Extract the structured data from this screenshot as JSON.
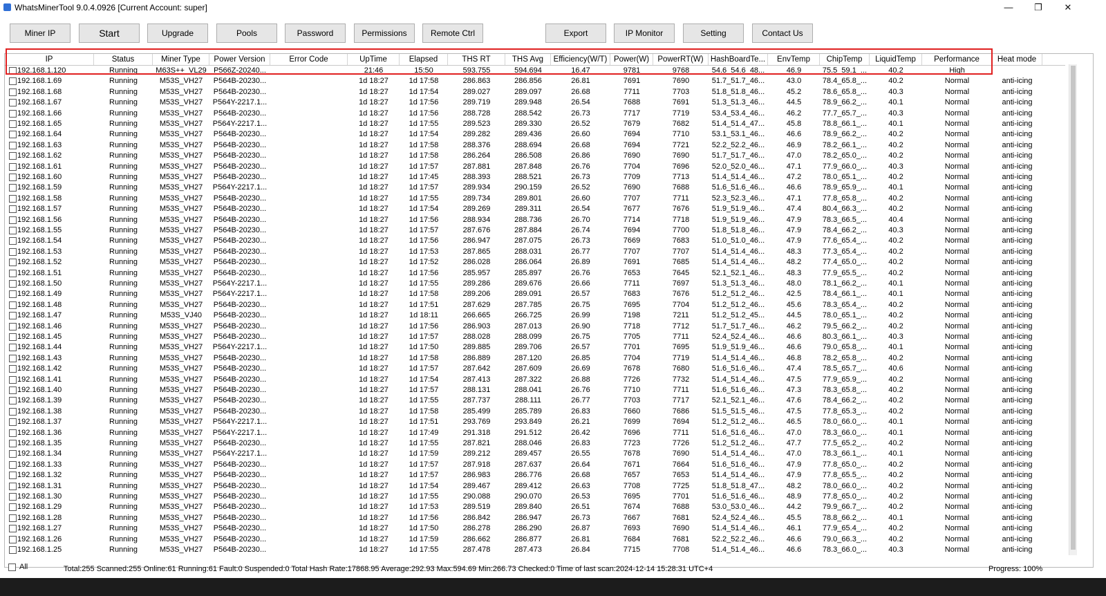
{
  "window": {
    "title": "WhatsMinerTool 9.0.4.0926 [Current Account: super]",
    "minimize": "—",
    "maximize": "❐",
    "close": "✕"
  },
  "toolbar": [
    {
      "label": "Miner IP"
    },
    {
      "label": "Start"
    },
    {
      "label": "Upgrade"
    },
    {
      "label": "Pools"
    },
    {
      "label": "Password"
    },
    {
      "label": "Permissions"
    },
    {
      "label": "Remote Ctrl"
    },
    {
      "label": "Export"
    },
    {
      "label": "IP Monitor"
    },
    {
      "label": "Setting"
    },
    {
      "label": "Contact Us"
    }
  ],
  "columns": [
    "IP",
    "Status",
    "Miner Type",
    "Power Version",
    "Error Code",
    "UpTime",
    "Elapsed",
    "THS RT",
    "THS Avg",
    "Efficiency(W/T)",
    "Power(W)",
    "PowerRT(W)",
    "HashBoardTe...",
    "EnvTemp",
    "ChipTemp",
    "LiquidTemp",
    "Performance",
    "Heat mode"
  ],
  "rows": [
    [
      "192.168.1.120",
      "Running",
      "M63S++_VL29",
      "P566Z-20240...",
      "",
      "21:46",
      "15:50",
      "593.755",
      "594.694",
      "16.47",
      "9781",
      "9768",
      "54.6_54.6_48...",
      "46.9",
      "75.5_59.1_...",
      "40.2",
      "High",
      ""
    ],
    [
      "192.168.1.69",
      "Running",
      "M53S_VH27",
      "P564B-20230...",
      "",
      "1d 18:27",
      "1d 17:58",
      "286.863",
      "286.856",
      "26.81",
      "7691",
      "7690",
      "51.7_51.7_46...",
      "43.0",
      "78.4_65.8_...",
      "40.2",
      "Normal",
      "anti-icing"
    ],
    [
      "192.168.1.68",
      "Running",
      "M53S_VH27",
      "P564B-20230...",
      "",
      "1d 18:27",
      "1d 17:54",
      "289.027",
      "289.097",
      "26.68",
      "7711",
      "7703",
      "51.8_51.8_46...",
      "45.2",
      "78.6_65.8_...",
      "40.3",
      "Normal",
      "anti-icing"
    ],
    [
      "192.168.1.67",
      "Running",
      "M53S_VH27",
      "P564Y-2217.1...",
      "",
      "1d 18:27",
      "1d 17:56",
      "289.719",
      "289.948",
      "26.54",
      "7688",
      "7691",
      "51.3_51.3_46...",
      "44.5",
      "78.9_66.2_...",
      "40.1",
      "Normal",
      "anti-icing"
    ],
    [
      "192.168.1.66",
      "Running",
      "M53S_VH27",
      "P564B-20230...",
      "",
      "1d 18:27",
      "1d 17:56",
      "288.728",
      "288.542",
      "26.73",
      "7717",
      "7719",
      "53.4_53.4_46...",
      "46.2",
      "77.7_65.7_...",
      "40.3",
      "Normal",
      "anti-icing"
    ],
    [
      "192.168.1.65",
      "Running",
      "M53S_VH27",
      "P564Y-2217.1...",
      "",
      "1d 18:27",
      "1d 17:55",
      "289.523",
      "289.330",
      "26.52",
      "7679",
      "7682",
      "51.4_51.4_47...",
      "45.8",
      "78.8_66.1_...",
      "40.1",
      "Normal",
      "anti-icing"
    ],
    [
      "192.168.1.64",
      "Running",
      "M53S_VH27",
      "P564B-20230...",
      "",
      "1d 18:27",
      "1d 17:54",
      "289.282",
      "289.436",
      "26.60",
      "7694",
      "7710",
      "53.1_53.1_46...",
      "46.6",
      "78.9_66.2_...",
      "40.2",
      "Normal",
      "anti-icing"
    ],
    [
      "192.168.1.63",
      "Running",
      "M53S_VH27",
      "P564B-20230...",
      "",
      "1d 18:27",
      "1d 17:58",
      "288.376",
      "288.694",
      "26.68",
      "7694",
      "7721",
      "52.2_52.2_46...",
      "46.9",
      "78.2_66.1_...",
      "40.2",
      "Normal",
      "anti-icing"
    ],
    [
      "192.168.1.62",
      "Running",
      "M53S_VH27",
      "P564B-20230...",
      "",
      "1d 18:27",
      "1d 17:58",
      "286.264",
      "286.508",
      "26.86",
      "7690",
      "7690",
      "51.7_51.7_46...",
      "47.0",
      "78.2_65.0_...",
      "40.2",
      "Normal",
      "anti-icing"
    ],
    [
      "192.168.1.61",
      "Running",
      "M53S_VH27",
      "P564B-20230...",
      "",
      "1d 18:27",
      "1d 17:57",
      "287.881",
      "287.848",
      "26.76",
      "7704",
      "7696",
      "52.0_52.0_46...",
      "47.1",
      "77.9_66.0_...",
      "40.3",
      "Normal",
      "anti-icing"
    ],
    [
      "192.168.1.60",
      "Running",
      "M53S_VH27",
      "P564B-20230...",
      "",
      "1d 18:27",
      "1d 17:45",
      "288.393",
      "288.521",
      "26.73",
      "7709",
      "7713",
      "51.4_51.4_46...",
      "47.2",
      "78.0_65.1_...",
      "40.2",
      "Normal",
      "anti-icing"
    ],
    [
      "192.168.1.59",
      "Running",
      "M53S_VH27",
      "P564Y-2217.1...",
      "",
      "1d 18:27",
      "1d 17:57",
      "289.934",
      "290.159",
      "26.52",
      "7690",
      "7688",
      "51.6_51.6_46...",
      "46.6",
      "78.9_65.9_...",
      "40.1",
      "Normal",
      "anti-icing"
    ],
    [
      "192.168.1.58",
      "Running",
      "M53S_VH27",
      "P564B-20230...",
      "",
      "1d 18:27",
      "1d 17:55",
      "289.734",
      "289.801",
      "26.60",
      "7707",
      "7711",
      "52.3_52.3_46...",
      "47.1",
      "77.8_65.8_...",
      "40.2",
      "Normal",
      "anti-icing"
    ],
    [
      "192.168.1.57",
      "Running",
      "M53S_VH27",
      "P564B-20230...",
      "",
      "1d 18:27",
      "1d 17:54",
      "289.269",
      "289.311",
      "26.54",
      "7677",
      "7676",
      "51.9_51.9_46...",
      "47.4",
      "80.4_66.3_...",
      "40.2",
      "Normal",
      "anti-icing"
    ],
    [
      "192.168.1.56",
      "Running",
      "M53S_VH27",
      "P564B-20230...",
      "",
      "1d 18:27",
      "1d 17:56",
      "288.934",
      "288.736",
      "26.70",
      "7714",
      "7718",
      "51.9_51.9_46...",
      "47.9",
      "78.3_66.5_...",
      "40.4",
      "Normal",
      "anti-icing"
    ],
    [
      "192.168.1.55",
      "Running",
      "M53S_VH27",
      "P564B-20230...",
      "",
      "1d 18:27",
      "1d 17:57",
      "287.676",
      "287.884",
      "26.74",
      "7694",
      "7700",
      "51.8_51.8_46...",
      "47.9",
      "78.4_66.2_...",
      "40.3",
      "Normal",
      "anti-icing"
    ],
    [
      "192.168.1.54",
      "Running",
      "M53S_VH27",
      "P564B-20230...",
      "",
      "1d 18:27",
      "1d 17:56",
      "286.947",
      "287.075",
      "26.73",
      "7669",
      "7683",
      "51.0_51.0_46...",
      "47.9",
      "77.6_65.4_...",
      "40.2",
      "Normal",
      "anti-icing"
    ],
    [
      "192.168.1.53",
      "Running",
      "M53S_VH27",
      "P564B-20230...",
      "",
      "1d 18:27",
      "1d 17:53",
      "287.865",
      "288.031",
      "26.77",
      "7707",
      "7707",
      "51.4_51.4_46...",
      "48.3",
      "77.3_65.4_...",
      "40.2",
      "Normal",
      "anti-icing"
    ],
    [
      "192.168.1.52",
      "Running",
      "M53S_VH27",
      "P564B-20230...",
      "",
      "1d 18:27",
      "1d 17:52",
      "286.028",
      "286.064",
      "26.89",
      "7691",
      "7685",
      "51.4_51.4_46...",
      "48.2",
      "77.4_65.0_...",
      "40.2",
      "Normal",
      "anti-icing"
    ],
    [
      "192.168.1.51",
      "Running",
      "M53S_VH27",
      "P564B-20230...",
      "",
      "1d 18:27",
      "1d 17:56",
      "285.957",
      "285.897",
      "26.76",
      "7653",
      "7645",
      "52.1_52.1_46...",
      "48.3",
      "77.9_65.5_...",
      "40.2",
      "Normal",
      "anti-icing"
    ],
    [
      "192.168.1.50",
      "Running",
      "M53S_VH27",
      "P564Y-2217.1...",
      "",
      "1d 18:27",
      "1d 17:55",
      "289.286",
      "289.676",
      "26.66",
      "7711",
      "7697",
      "51.3_51.3_46...",
      "48.0",
      "78.1_66.2_...",
      "40.1",
      "Normal",
      "anti-icing"
    ],
    [
      "192.168.1.49",
      "Running",
      "M53S_VH27",
      "P564Y-2217.1...",
      "",
      "1d 18:27",
      "1d 17:58",
      "289.206",
      "289.091",
      "26.57",
      "7683",
      "7676",
      "51.2_51.2_46...",
      "42.5",
      "78.4_66.1_...",
      "40.1",
      "Normal",
      "anti-icing"
    ],
    [
      "192.168.1.48",
      "Running",
      "M53S_VH27",
      "P564B-20230...",
      "",
      "1d 18:27",
      "1d 17:51",
      "287.629",
      "287.785",
      "26.75",
      "7695",
      "7704",
      "51.2_51.2_46...",
      "45.6",
      "78.3_65.4_...",
      "40.2",
      "Normal",
      "anti-icing"
    ],
    [
      "192.168.1.47",
      "Running",
      "M53S_VJ40",
      "P564B-20230...",
      "",
      "1d 18:27",
      "1d 18:11",
      "266.665",
      "266.725",
      "26.99",
      "7198",
      "7211",
      "51.2_51.2_45...",
      "44.5",
      "78.0_65.1_...",
      "40.2",
      "Normal",
      "anti-icing"
    ],
    [
      "192.168.1.46",
      "Running",
      "M53S_VH27",
      "P564B-20230...",
      "",
      "1d 18:27",
      "1d 17:56",
      "286.903",
      "287.013",
      "26.90",
      "7718",
      "7712",
      "51.7_51.7_46...",
      "46.2",
      "79.5_66.2_...",
      "40.2",
      "Normal",
      "anti-icing"
    ],
    [
      "192.168.1.45",
      "Running",
      "M53S_VH27",
      "P564B-20230...",
      "",
      "1d 18:27",
      "1d 17:57",
      "288.028",
      "288.099",
      "26.75",
      "7705",
      "7711",
      "52.4_52.4_46...",
      "46.6",
      "80.3_66.1_...",
      "40.3",
      "Normal",
      "anti-icing"
    ],
    [
      "192.168.1.44",
      "Running",
      "M53S_VH27",
      "P564Y-2217.1...",
      "",
      "1d 18:27",
      "1d 17:50",
      "289.885",
      "289.706",
      "26.57",
      "7701",
      "7695",
      "51.9_51.9_46...",
      "46.6",
      "79.0_65.8_...",
      "40.1",
      "Normal",
      "anti-icing"
    ],
    [
      "192.168.1.43",
      "Running",
      "M53S_VH27",
      "P564B-20230...",
      "",
      "1d 18:27",
      "1d 17:58",
      "286.889",
      "287.120",
      "26.85",
      "7704",
      "7719",
      "51.4_51.4_46...",
      "46.8",
      "78.2_65.8_...",
      "40.2",
      "Normal",
      "anti-icing"
    ],
    [
      "192.168.1.42",
      "Running",
      "M53S_VH27",
      "P564B-20230...",
      "",
      "1d 18:27",
      "1d 17:57",
      "287.642",
      "287.609",
      "26.69",
      "7678",
      "7680",
      "51.6_51.6_46...",
      "47.4",
      "78.5_65.7_...",
      "40.6",
      "Normal",
      "anti-icing"
    ],
    [
      "192.168.1.41",
      "Running",
      "M53S_VH27",
      "P564B-20230...",
      "",
      "1d 18:27",
      "1d 17:54",
      "287.413",
      "287.322",
      "26.88",
      "7726",
      "7732",
      "51.4_51.4_46...",
      "47.5",
      "77.9_65.9_...",
      "40.2",
      "Normal",
      "anti-icing"
    ],
    [
      "192.168.1.40",
      "Running",
      "M53S_VH27",
      "P564B-20230...",
      "",
      "1d 18:27",
      "1d 17:57",
      "288.131",
      "288.041",
      "26.76",
      "7710",
      "7711",
      "51.6_51.6_46...",
      "47.3",
      "78.3_65.8_...",
      "40.2",
      "Normal",
      "anti-icing"
    ],
    [
      "192.168.1.39",
      "Running",
      "M53S_VH27",
      "P564B-20230...",
      "",
      "1d 18:27",
      "1d 17:55",
      "287.737",
      "288.111",
      "26.77",
      "7703",
      "7717",
      "52.1_52.1_46...",
      "47.6",
      "78.4_66.2_...",
      "40.2",
      "Normal",
      "anti-icing"
    ],
    [
      "192.168.1.38",
      "Running",
      "M53S_VH27",
      "P564B-20230...",
      "",
      "1d 18:27",
      "1d 17:58",
      "285.499",
      "285.789",
      "26.83",
      "7660",
      "7686",
      "51.5_51.5_46...",
      "47.5",
      "77.8_65.3_...",
      "40.2",
      "Normal",
      "anti-icing"
    ],
    [
      "192.168.1.37",
      "Running",
      "M53S_VH27",
      "P564Y-2217.1...",
      "",
      "1d 18:27",
      "1d 17:51",
      "293.769",
      "293.849",
      "26.21",
      "7699",
      "7694",
      "51.2_51.2_46...",
      "46.5",
      "78.0_66.0_...",
      "40.1",
      "Normal",
      "anti-icing"
    ],
    [
      "192.168.1.36",
      "Running",
      "M53S_VH27",
      "P564Y-2217.1...",
      "",
      "1d 18:27",
      "1d 17:49",
      "291.318",
      "291.512",
      "26.42",
      "7696",
      "7711",
      "51.6_51.6_46...",
      "47.0",
      "78.3_66.0_...",
      "40.1",
      "Normal",
      "anti-icing"
    ],
    [
      "192.168.1.35",
      "Running",
      "M53S_VH27",
      "P564B-20230...",
      "",
      "1d 18:27",
      "1d 17:55",
      "287.821",
      "288.046",
      "26.83",
      "7723",
      "7726",
      "51.2_51.2_46...",
      "47.7",
      "77.5_65.2_...",
      "40.2",
      "Normal",
      "anti-icing"
    ],
    [
      "192.168.1.34",
      "Running",
      "M53S_VH27",
      "P564Y-2217.1...",
      "",
      "1d 18:27",
      "1d 17:59",
      "289.212",
      "289.457",
      "26.55",
      "7678",
      "7690",
      "51.4_51.4_46...",
      "47.0",
      "78.3_66.1_...",
      "40.1",
      "Normal",
      "anti-icing"
    ],
    [
      "192.168.1.33",
      "Running",
      "M53S_VH27",
      "P564B-20230...",
      "",
      "1d 18:27",
      "1d 17:57",
      "287.918",
      "287.637",
      "26.64",
      "7671",
      "7664",
      "51.6_51.6_46...",
      "47.9",
      "77.8_65.0_...",
      "40.2",
      "Normal",
      "anti-icing"
    ],
    [
      "192.168.1.32",
      "Running",
      "M53S_VH27",
      "P564B-20230...",
      "",
      "1d 18:27",
      "1d 17:57",
      "286.983",
      "286.776",
      "26.68",
      "7657",
      "7653",
      "51.4_51.4_46...",
      "47.9",
      "77.8_65.5_...",
      "40.2",
      "Normal",
      "anti-icing"
    ],
    [
      "192.168.1.31",
      "Running",
      "M53S_VH27",
      "P564B-20230...",
      "",
      "1d 18:27",
      "1d 17:54",
      "289.467",
      "289.412",
      "26.63",
      "7708",
      "7725",
      "51.8_51.8_47...",
      "48.2",
      "78.0_66.0_...",
      "40.2",
      "Normal",
      "anti-icing"
    ],
    [
      "192.168.1.30",
      "Running",
      "M53S_VH27",
      "P564B-20230...",
      "",
      "1d 18:27",
      "1d 17:55",
      "290.088",
      "290.070",
      "26.53",
      "7695",
      "7701",
      "51.6_51.6_46...",
      "48.9",
      "77.8_65.0_...",
      "40.2",
      "Normal",
      "anti-icing"
    ],
    [
      "192.168.1.29",
      "Running",
      "M53S_VH27",
      "P564B-20230...",
      "",
      "1d 18:27",
      "1d 17:53",
      "289.519",
      "289.840",
      "26.51",
      "7674",
      "7688",
      "53.0_53.0_46...",
      "44.2",
      "79.9_66.7_...",
      "40.2",
      "Normal",
      "anti-icing"
    ],
    [
      "192.168.1.28",
      "Running",
      "M53S_VH27",
      "P564B-20230...",
      "",
      "1d 18:27",
      "1d 17:56",
      "286.842",
      "286.947",
      "26.73",
      "7667",
      "7681",
      "52.4_52.4_46...",
      "45.5",
      "78.8_66.2_...",
      "40.1",
      "Normal",
      "anti-icing"
    ],
    [
      "192.168.1.27",
      "Running",
      "M53S_VH27",
      "P564B-20230...",
      "",
      "1d 18:27",
      "1d 17:50",
      "286.278",
      "286.290",
      "26.87",
      "7693",
      "7690",
      "51.4_51.4_46...",
      "46.1",
      "77.9_65.4_...",
      "40.2",
      "Normal",
      "anti-icing"
    ],
    [
      "192.168.1.26",
      "Running",
      "M53S_VH27",
      "P564B-20230...",
      "",
      "1d 18:27",
      "1d 17:59",
      "286.662",
      "286.877",
      "26.81",
      "7684",
      "7681",
      "52.2_52.2_46...",
      "46.6",
      "79.0_66.3_...",
      "40.2",
      "Normal",
      "anti-icing"
    ],
    [
      "192.168.1.25",
      "Running",
      "M53S_VH27",
      "P564B-20230...",
      "",
      "1d 18:27",
      "1d 17:55",
      "287.478",
      "287.473",
      "26.84",
      "7715",
      "7708",
      "51.4_51.4_46...",
      "46.6",
      "78.3_66.0_...",
      "40.3",
      "Normal",
      "anti-icing"
    ]
  ],
  "status": {
    "all_label": "All",
    "summary": "Total:255  Scanned:255  Online:61  Running:61  Fault:0  Suspended:0  Total Hash Rate:17868.95  Average:292.93  Max:594.69  Min:266.73  Checked:0  Time of last scan:2024-12-14 15:28:31 UTC+4",
    "progress": "Progress: 100%"
  },
  "colors": {
    "highlight": "#e02020",
    "button_bg": "#e6e6e6",
    "taskbar": "#1c1c1c"
  }
}
